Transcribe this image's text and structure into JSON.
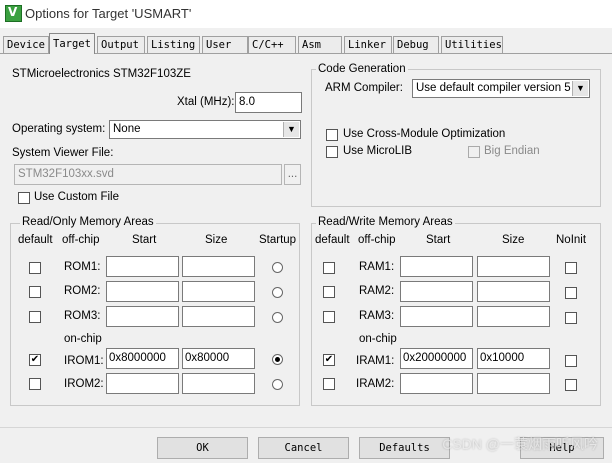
{
  "window": {
    "title": "Options for Target 'USMART'",
    "icon_text": "V"
  },
  "tabs": [
    "Device",
    "Target",
    "Output",
    "Listing",
    "User",
    "C/C++",
    "Asm",
    "Linker",
    "Debug",
    "Utilities"
  ],
  "target": {
    "device_name": "STMicroelectronics STM32F103ZE",
    "xtal_label": "Xtal (MHz):",
    "xtal_value": "8.0",
    "os_label": "Operating system:",
    "os_value": "None",
    "svf_label": "System Viewer File:",
    "svf_value": "STM32F103xx.svd",
    "browse_label": "...",
    "custom_file_label": "Use Custom File"
  },
  "codegen": {
    "title": "Code Generation",
    "compiler_label": "ARM Compiler:",
    "compiler_value": "Use default compiler version 5",
    "cross_module": "Use Cross-Module Optimization",
    "microlib": "Use MicroLIB",
    "big_endian": "Big Endian"
  },
  "ro_memory": {
    "title": "Read/Only Memory Areas",
    "headers": {
      "default": "default",
      "offchip": "off-chip",
      "start": "Start",
      "size": "Size",
      "extra": "Startup"
    },
    "onchip_label": "on-chip",
    "rows": [
      {
        "name": "ROM1:",
        "start": "",
        "size": "",
        "default": false,
        "startup": false
      },
      {
        "name": "ROM2:",
        "start": "",
        "size": "",
        "default": false,
        "startup": false
      },
      {
        "name": "ROM3:",
        "start": "",
        "size": "",
        "default": false,
        "startup": false
      },
      {
        "name": "IROM1:",
        "start": "0x8000000",
        "size": "0x80000",
        "default": true,
        "startup": true
      },
      {
        "name": "IROM2:",
        "start": "",
        "size": "",
        "default": false,
        "startup": false
      }
    ]
  },
  "rw_memory": {
    "title": "Read/Write Memory Areas",
    "headers": {
      "default": "default",
      "offchip": "off-chip",
      "start": "Start",
      "size": "Size",
      "extra": "NoInit"
    },
    "onchip_label": "on-chip",
    "rows": [
      {
        "name": "RAM1:",
        "start": "",
        "size": "",
        "default": false,
        "noinit": false
      },
      {
        "name": "RAM2:",
        "start": "",
        "size": "",
        "default": false,
        "noinit": false
      },
      {
        "name": "RAM3:",
        "start": "",
        "size": "",
        "default": false,
        "noinit": false
      },
      {
        "name": "IRAM1:",
        "start": "0x20000000",
        "size": "0x10000",
        "default": true,
        "noinit": false
      },
      {
        "name": "IRAM2:",
        "start": "",
        "size": "",
        "default": false,
        "noinit": false
      }
    ]
  },
  "buttons": {
    "ok": "OK",
    "cancel": "Cancel",
    "defaults": "Defaults",
    "help": "Help"
  },
  "watermark": "CSDN @一蓑烟雨听风吟"
}
